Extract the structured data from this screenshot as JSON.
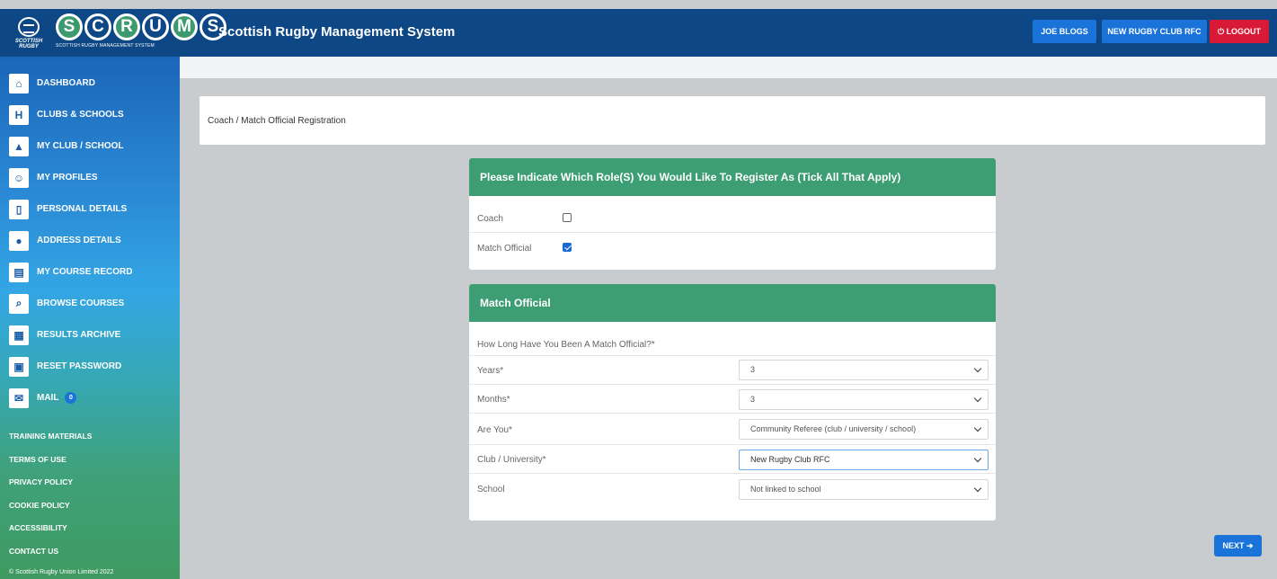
{
  "header": {
    "crest_text": "SCOTTISH RUGBY",
    "logo_letters": [
      "S",
      "C",
      "R",
      "U",
      "M",
      "S"
    ],
    "logo_tagline": "SCOTTISH RUGBY MANAGEMENT SYSTEM",
    "title": "Scottish Rugby Management System",
    "user_button": "JOE BLOGS",
    "club_button": "NEW RUGBY CLUB RFC",
    "logout_button": "LOGOUT",
    "colors": {
      "header_bg": "#0d4785",
      "button_blue": "#1a73d8",
      "logout_red": "#d91a37"
    }
  },
  "sidebar": {
    "items": [
      {
        "label": "DASHBOARD",
        "icon": "dashboard-icon"
      },
      {
        "label": "CLUBS & SCHOOLS",
        "icon": "goalposts-icon"
      },
      {
        "label": "MY CLUB / SCHOOL",
        "icon": "club-icon"
      },
      {
        "label": "MY PROFILES",
        "icon": "profiles-icon"
      },
      {
        "label": "PERSONAL DETAILS",
        "icon": "personal-details-icon"
      },
      {
        "label": "ADDRESS DETAILS",
        "icon": "map-pin-icon"
      },
      {
        "label": "MY COURSE RECORD",
        "icon": "course-record-icon"
      },
      {
        "label": "BROWSE COURSES",
        "icon": "browse-courses-icon"
      },
      {
        "label": "RESULTS ARCHIVE",
        "icon": "results-archive-icon"
      },
      {
        "label": "RESET PASSWORD",
        "icon": "lock-icon"
      },
      {
        "label": "MAIL",
        "icon": "mail-icon",
        "badge": "0"
      }
    ],
    "footer_links": [
      "TRAINING MATERIALS",
      "TERMS OF USE",
      "PRIVACY POLICY",
      "COOKIE POLICY",
      "ACCESSIBILITY",
      "CONTACT US"
    ],
    "copyright": "© Scottish Rugby Union Limited 2022"
  },
  "main": {
    "breadcrumb": "Coach / Match Official Registration",
    "roles_panel": {
      "title": "Please Indicate Which Role(S) You Would Like To Register As (Tick All That Apply)",
      "options": [
        {
          "label": "Coach",
          "checked": false
        },
        {
          "label": "Match Official",
          "checked": true
        }
      ]
    },
    "official_panel": {
      "title": "Match Official",
      "question": "How Long Have You Been A Match Official?*",
      "fields": [
        {
          "label": "Years*",
          "value": "3"
        },
        {
          "label": "Months*",
          "value": "3"
        },
        {
          "label": "Are You*",
          "value": "Community Referee (club / university / school)"
        },
        {
          "label": "Club / University*",
          "value": "New Rugby Club RFC"
        },
        {
          "label": "School",
          "value": "Not linked to school"
        }
      ]
    },
    "next_button": "NEXT",
    "colors": {
      "panel_header": "#3d9d73",
      "check_blue": "#1a68d1"
    }
  }
}
